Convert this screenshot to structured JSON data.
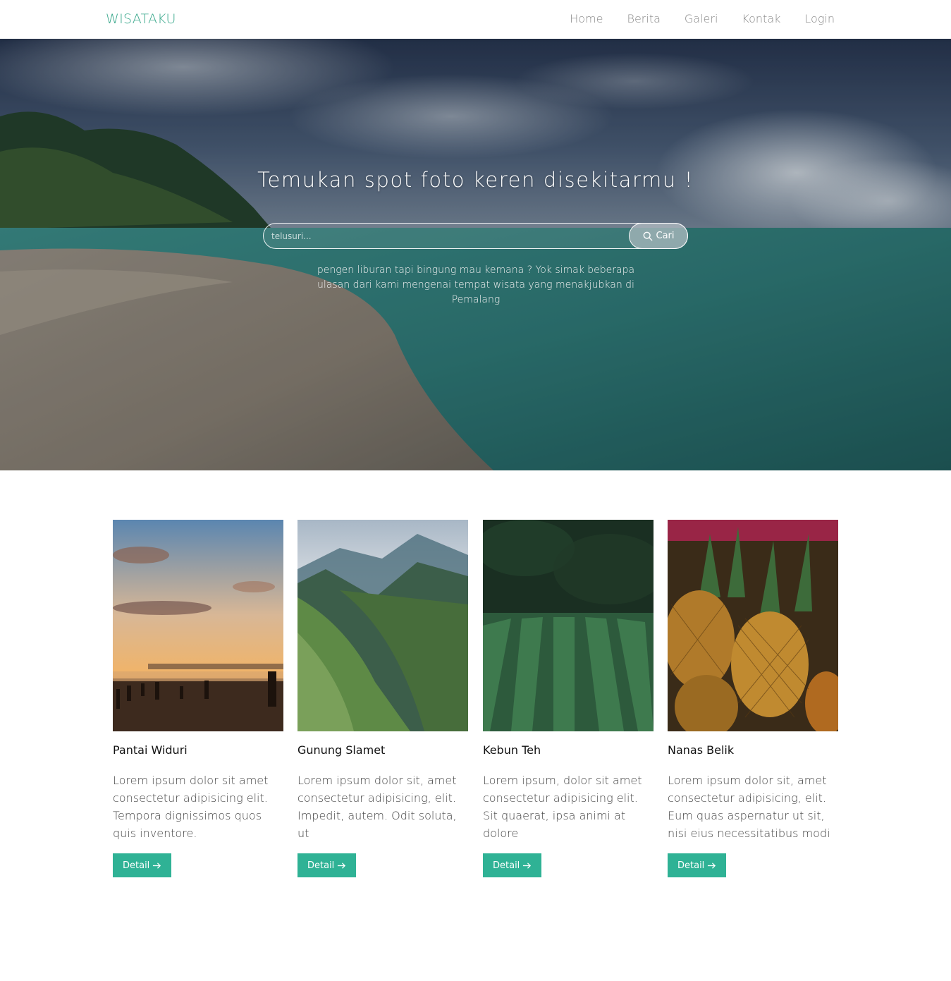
{
  "navbar": {
    "brand": "WISATAKU",
    "links": [
      "Home",
      "Berita",
      "Galeri",
      "Kontak",
      "Login"
    ]
  },
  "hero": {
    "title": "Temukan spot foto keren disekitarmu !",
    "search": {
      "placeholder": "telusuri...",
      "button_label": "Cari",
      "button_icon": "search-icon"
    },
    "description": "pengen liburan tapi bingung mau kemana ? Yok simak beberapa ulasan dari kami mengenai tempat wisata yang menakjubkan di Pemalang"
  },
  "cards": [
    {
      "title": "Pantai Widuri",
      "text": "Lorem ipsum dolor sit amet consectetur adipisicing elit. Tempora dignissimos quos quis inventore.",
      "button_label": "Detail",
      "button_icon": "arrow-right-icon",
      "image": "beach-sunset-photo"
    },
    {
      "title": "Gunung Slamet",
      "text": "Lorem ipsum dolor sit, amet consectetur adipisicing, elit. Impedit, autem. Odit soluta, ut",
      "button_label": "Detail",
      "button_icon": "arrow-right-icon",
      "image": "mountain-photo"
    },
    {
      "title": "Kebun Teh",
      "text": "Lorem ipsum, dolor sit amet consectetur adipisicing elit. Sit quaerat, ipsa animi at dolore",
      "button_label": "Detail",
      "button_icon": "arrow-right-icon",
      "image": "tea-plantation-photo"
    },
    {
      "title": "Nanas Belik",
      "text": "Lorem ipsum dolor sit, amet consectetur adipisicing, elit. Eum quas aspernatur ut sit, nisi eius necessitatibus modi",
      "button_label": "Detail",
      "button_icon": "arrow-right-icon",
      "image": "pineapple-photo"
    }
  ],
  "colors": {
    "brand": "#3aa88c",
    "button": "#2fb295"
  }
}
